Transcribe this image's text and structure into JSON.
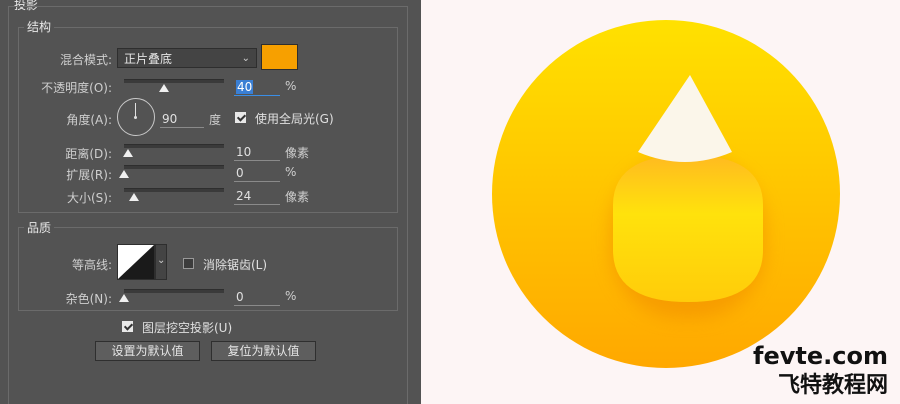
{
  "panel": {
    "section_title": "投影",
    "structure": {
      "title": "结构",
      "blend_mode_label": "混合模式:",
      "blend_mode_value": "正片叠底",
      "shadow_color": "#f7a000",
      "opacity_label": "不透明度(O):",
      "opacity_value": "40",
      "opacity_unit": "%",
      "opacity_level": 40,
      "angle_label": "角度(A):",
      "angle_value": "90",
      "angle_unit": "度",
      "global_light_label": "使用全局光(G)",
      "global_light_checked": true,
      "distance_label": "距离(D):",
      "distance_value": "10",
      "distance_unit": "像素",
      "distance_level": 4,
      "spread_label": "扩展(R):",
      "spread_value": "0",
      "spread_unit": "%",
      "spread_level": 0,
      "size_label": "大小(S):",
      "size_value": "24",
      "size_unit": "像素",
      "size_level": 10
    },
    "quality": {
      "title": "品质",
      "contour_label": "等高线:",
      "anti_alias_label": "消除锯齿(L)",
      "anti_alias_checked": false,
      "noise_label": "杂色(N):",
      "noise_value": "0",
      "noise_unit": "%",
      "noise_level": 0
    },
    "knockout_label": "图层挖空投影(U)",
    "knockout_checked": true,
    "make_default_label": "设置为默认值",
    "reset_default_label": "复位为默认值"
  },
  "preview": {
    "background": "#fdf5f5",
    "coin_color_top": "#ffe100",
    "coin_color_bottom": "#ffa800",
    "watermark_line1": "fevte.com",
    "watermark_line2": "飞特教程网"
  }
}
